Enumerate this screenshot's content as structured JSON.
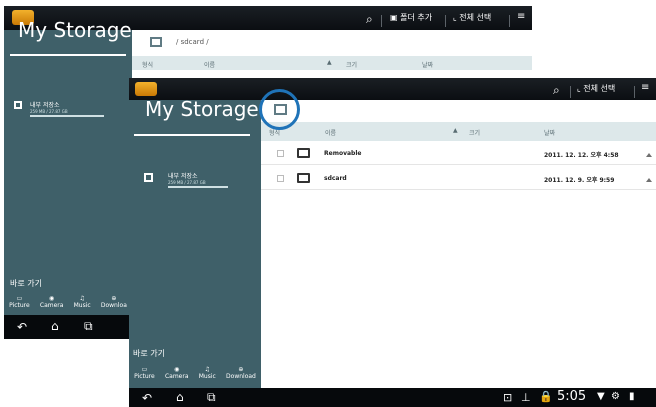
{
  "back": {
    "toolbar": {
      "add_folder": "폴더 추가",
      "select_all": "전체 선택"
    },
    "sidebar": {
      "title": "My Storage",
      "storage_label": "내부 저장소",
      "storage_size": "259 MB / 27.87 GB",
      "quick_access": "바로 가기",
      "shortcuts": [
        "Picture",
        "Camera",
        "Music",
        "Downloa"
      ]
    },
    "path": "/ sdcard /",
    "columns": {
      "type": "형식",
      "name": "이름",
      "size": "크기",
      "date": "날짜"
    }
  },
  "front": {
    "toolbar": {
      "select_all": "전체 선택"
    },
    "sidebar": {
      "title": "My Storage",
      "storage_label": "내부 저장소",
      "storage_size": "259 MB / 27.87 GB",
      "quick_access": "바로 가기",
      "shortcuts": [
        "Picture",
        "Camera",
        "Music",
        "Download"
      ]
    },
    "columns": {
      "type": "형식",
      "name": "이름",
      "size": "크기",
      "date": "날짜"
    },
    "rows": [
      {
        "name": "Removable",
        "date": "2011. 12. 12. 오후 4:58"
      },
      {
        "name": "sdcard",
        "date": "2011. 12. 9. 오후 9:59"
      }
    ],
    "clock": "5:05"
  },
  "colors": {
    "sidebar": "#3f6069",
    "header": "#dde8ea",
    "topbar": "#111519",
    "highlight": "#1f73b8"
  }
}
